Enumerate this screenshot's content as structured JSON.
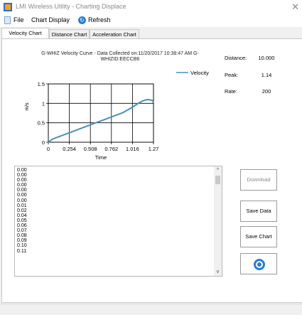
{
  "window": {
    "title": "LMI Wireless Utility - Charting Displace",
    "close_glyph": "✕"
  },
  "menu": {
    "file": "File",
    "chart_display": "Chart Display",
    "refresh": "Refresh",
    "refresh_icon": "refresh-icon"
  },
  "tabs": [
    {
      "label": "Velocity Chart",
      "active": true
    },
    {
      "label": "Distance Chart",
      "active": false
    },
    {
      "label": "Acceleration Chart",
      "active": false
    }
  ],
  "chart_data": {
    "type": "line",
    "title_line1": "G-WHIZ Velocity Curve - Data Collected on:11/20/2017 10:38:47 AM G-",
    "title_line2": "WHIZID:EECCB6",
    "xlabel": "Time",
    "ylabel": "m/s",
    "xlim": [
      0,
      1.27
    ],
    "ylim": [
      0,
      1.5
    ],
    "xticks": [
      "0",
      "0.254",
      "0.508",
      "0.762",
      "1.016",
      "1.27"
    ],
    "yticks": [
      "0",
      "0.5",
      "1",
      "1.5"
    ],
    "grid": true,
    "legend_position": "top-right",
    "series": [
      {
        "name": "Velocity",
        "color": "#4a90b8",
        "x": [
          0,
          0.05,
          0.1,
          0.2,
          0.3,
          0.4,
          0.5,
          0.6,
          0.7,
          0.8,
          0.9,
          1.0,
          1.05,
          1.1,
          1.15,
          1.2,
          1.25,
          1.27
        ],
        "y": [
          0,
          0.08,
          0.12,
          0.2,
          0.28,
          0.36,
          0.44,
          0.52,
          0.6,
          0.68,
          0.76,
          0.88,
          0.95,
          1.02,
          1.07,
          1.1,
          1.08,
          1.03
        ]
      }
    ]
  },
  "stats": {
    "distance_label": "Distance:",
    "distance_value": "10.000",
    "peak_label": "Peak:",
    "peak_value": "1.14",
    "rate_label": "Rate:",
    "rate_value": "200"
  },
  "data_list": [
    "0.00",
    "0.00",
    "0.00",
    "0.00",
    "0.00",
    "0.00",
    "0.00",
    "0.01",
    "0.02",
    "0.04",
    "0.05",
    "0.06",
    "0.07",
    "0.08",
    "0.09",
    "0.10",
    "0.11"
  ],
  "scroll": {
    "up": "^",
    "down": "v"
  },
  "buttons": {
    "download": "Download",
    "save_data": "Save Data",
    "save_chart": "Save Chart",
    "sync_icon": "sync-icon"
  }
}
